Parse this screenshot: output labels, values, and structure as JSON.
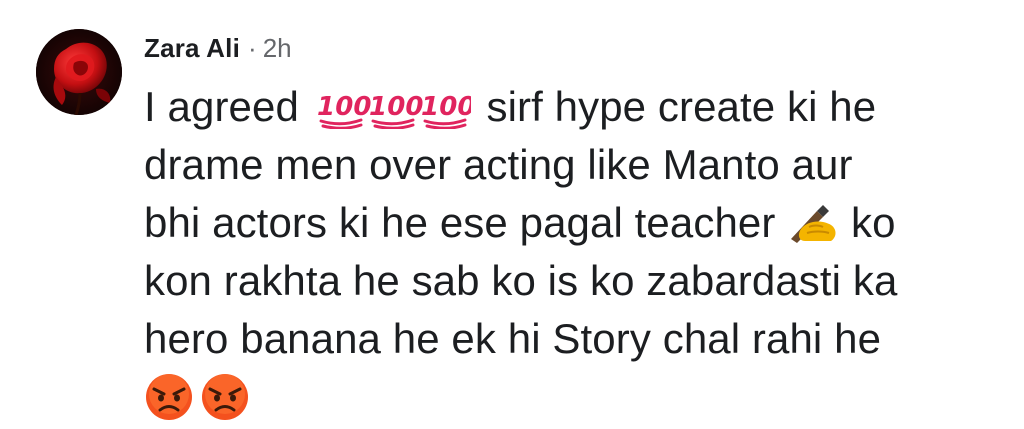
{
  "comment": {
    "author": "Zara Ali",
    "separator": "·",
    "time": "2h",
    "lines": [
      {
        "before": "I agreed",
        "after": "sirf hype create ki he"
      },
      {
        "text": "drame men over acting like Manto aur"
      },
      {
        "before": "bhi actors ki he ese pagal teacher",
        "after": "ko"
      },
      {
        "text": "kon rakhta he sab ko is ko zabardasti ka"
      },
      {
        "text": "hero banana he ek hi Story chal rahi he"
      }
    ],
    "emojis": {
      "hundred": {
        "name": "hundred-points-emoji",
        "count": 3,
        "glyph": "100",
        "color": "#e0245e"
      },
      "writing": {
        "name": "writing-hand-emoji",
        "color": "#f4b400"
      },
      "angry": {
        "name": "angry-face-emoji",
        "count": 2,
        "color": "#f4511e"
      }
    }
  },
  "colors": {
    "text": "#1c1e21",
    "muted": "#65676b",
    "background": "#ffffff"
  }
}
